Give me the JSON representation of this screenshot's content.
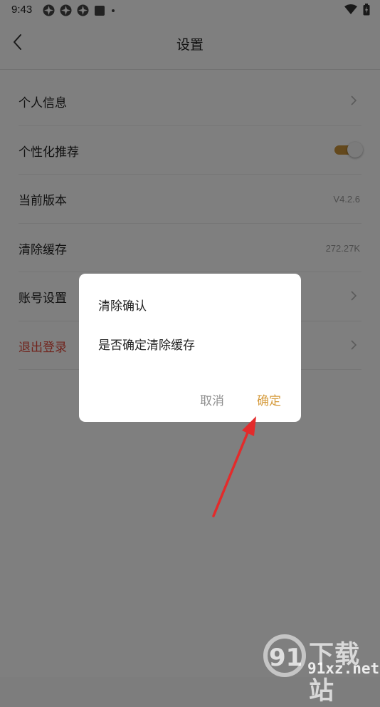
{
  "status_bar": {
    "time": "9:43"
  },
  "header": {
    "title": "设置"
  },
  "settings": {
    "items": [
      {
        "label": "个人信息"
      },
      {
        "label": "个性化推荐",
        "toggle": true
      },
      {
        "label": "当前版本",
        "value": "V4.2.6"
      },
      {
        "label": "清除缓存",
        "value": "272.27K"
      },
      {
        "label": "账号设置"
      },
      {
        "label": "退出登录"
      }
    ]
  },
  "dialog": {
    "title": "清除确认",
    "message": "是否确定清除缓存",
    "cancel": "取消",
    "confirm": "确定"
  },
  "watermark": {
    "text": "下载站",
    "url": "91xz.net",
    "logo": "91"
  },
  "colors": {
    "accent": "#d59a3a",
    "logout": "#e2493a",
    "toggle_on": "#c8923a",
    "annotation_arrow": "#e32b2b"
  }
}
